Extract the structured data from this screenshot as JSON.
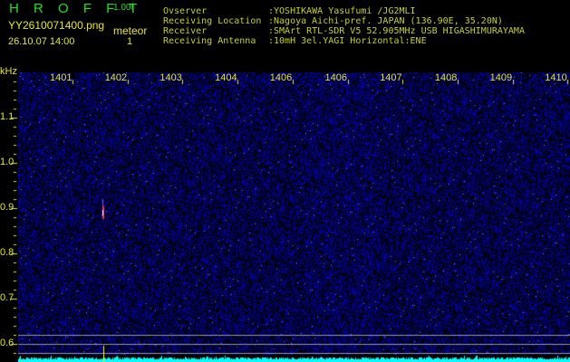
{
  "app": {
    "title_letters": "H R O F F T",
    "version": "1.00f"
  },
  "file": {
    "name": "YY2610071400.png",
    "datetime": "26.10.07 14:00"
  },
  "meteor": {
    "label": "meteor",
    "count": "1"
  },
  "info": [
    {
      "key": "Ovserver",
      "value": ":YOSHIKAWA Yasufumi /JG2MLI"
    },
    {
      "key": "Receiving Location",
      "value": ":Nagoya Aichi-pref. JAPAN (136.90E, 35.20N)"
    },
    {
      "key": "Receiver",
      "value": ":SMArt RTL-SDR V5 52.905MHz USB HIGASHIMURAYAMA"
    },
    {
      "key": "Receiving Antenna",
      "value": ":10mH 3el.YAGI Horizontal:ENE"
    }
  ],
  "axis": {
    "y_unit": "kHz",
    "y_labels": [
      "1.1",
      "1.0",
      "0.9",
      "0.8",
      "0.7",
      "0.6"
    ],
    "x_labels": [
      "1401",
      "1402",
      "1403",
      "1404",
      "1406",
      "1406",
      "1407",
      "1408",
      "1409",
      "1410"
    ]
  },
  "colors": {
    "background": "#000000",
    "noise": "#1a1aff",
    "baseline": "#00ffff",
    "axis": "#e6e62a",
    "title": "#22dd22"
  }
}
